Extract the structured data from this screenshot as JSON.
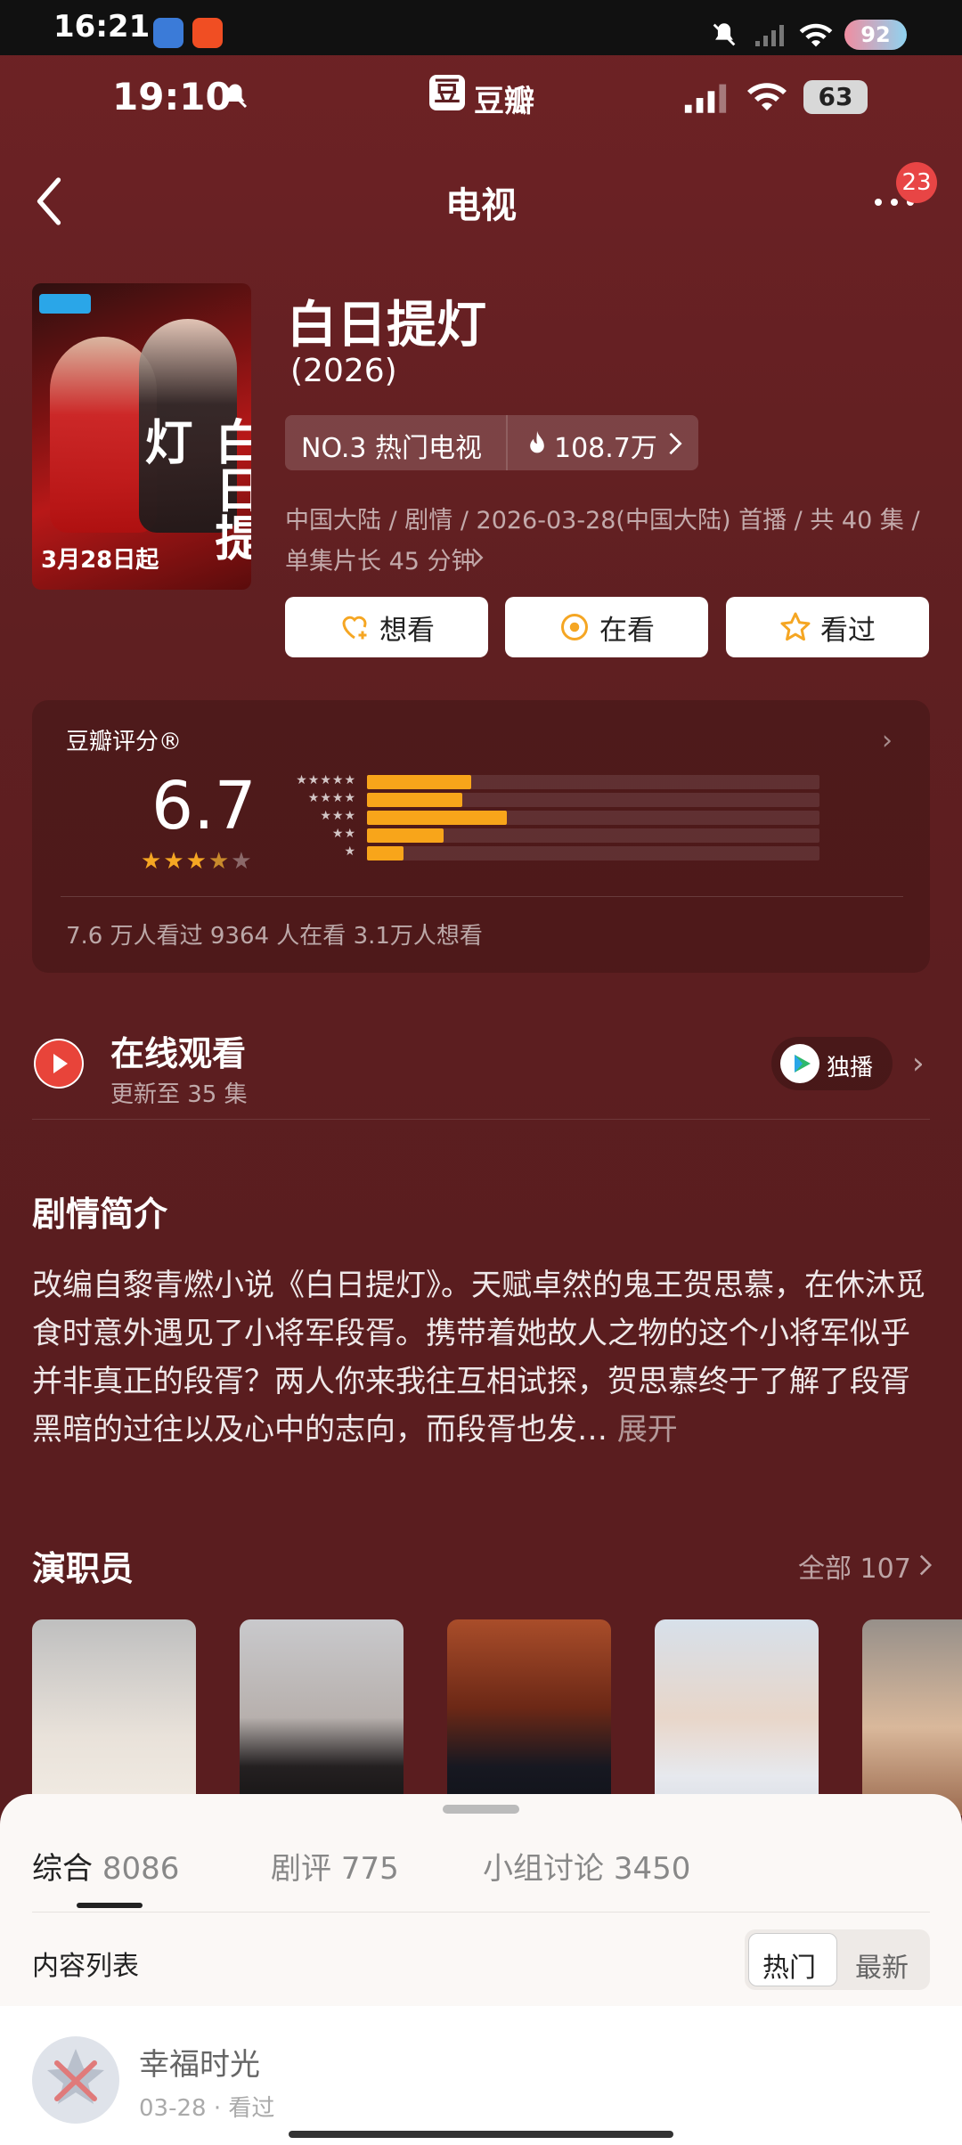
{
  "system_status": {
    "time": "16:21",
    "battery": "92"
  },
  "app_status": {
    "time": "19:10",
    "app_name": "豆瓣",
    "app_glyph": "豆",
    "battery": "63"
  },
  "header": {
    "title": "电视",
    "notification_count": "23"
  },
  "show": {
    "title": "白日提灯",
    "year": "(2026)",
    "rank": "NO.3 热门电视",
    "heat": "108.7万",
    "meta_line1": "中国大陆 / 剧情 / 2026-03-28(中国大陆) 首播 / 共 40 集 /",
    "meta_line2": "单集片长 45 分钟",
    "poster_title": "白日提灯",
    "poster_date": "3月28日起"
  },
  "actions": {
    "want": "想看",
    "watching": "在看",
    "watched": "看过"
  },
  "rating": {
    "label": "豆瓣评分®",
    "score": "6.7",
    "stars_value": 3.5,
    "distribution": [
      {
        "stars": 5,
        "fraction": 0.23
      },
      {
        "stars": 4,
        "fraction": 0.21
      },
      {
        "stars": 3,
        "fraction": 0.31
      },
      {
        "stars": 2,
        "fraction": 0.17
      },
      {
        "stars": 1,
        "fraction": 0.08
      }
    ],
    "stats": "7.6 万人看过   9364 人在看   3.1万人想看",
    "star_color": "#f8a51a"
  },
  "watch": {
    "title": "在线观看",
    "subtitle": "更新至 35 集",
    "exclusive": "独播"
  },
  "synopsis": {
    "title": "剧情简介",
    "text": "改编自黎青燃小说《白日提灯》。天赋卓然的鬼王贺思慕，在休沐觅食时意外遇见了小将军段胥。携带着她故人之物的这个小将军似乎并非真正的段胥？两人你来我往互相试探，贺思慕终于了解了段胥黑暗的过往以及心中的志向，而段胥也发…",
    "more": "展开"
  },
  "cast": {
    "title": "演职员",
    "all": "全部 107"
  },
  "sheet": {
    "tabs": [
      {
        "label": "综合",
        "count": "8086"
      },
      {
        "label": "剧评",
        "count": "775"
      },
      {
        "label": "小组讨论",
        "count": "3450"
      }
    ],
    "content_label": "内容列表",
    "sort_hot": "热门",
    "sort_new": "最新",
    "first_item_name": "幸福时光",
    "first_item_meta": "03-28 · 看过"
  }
}
